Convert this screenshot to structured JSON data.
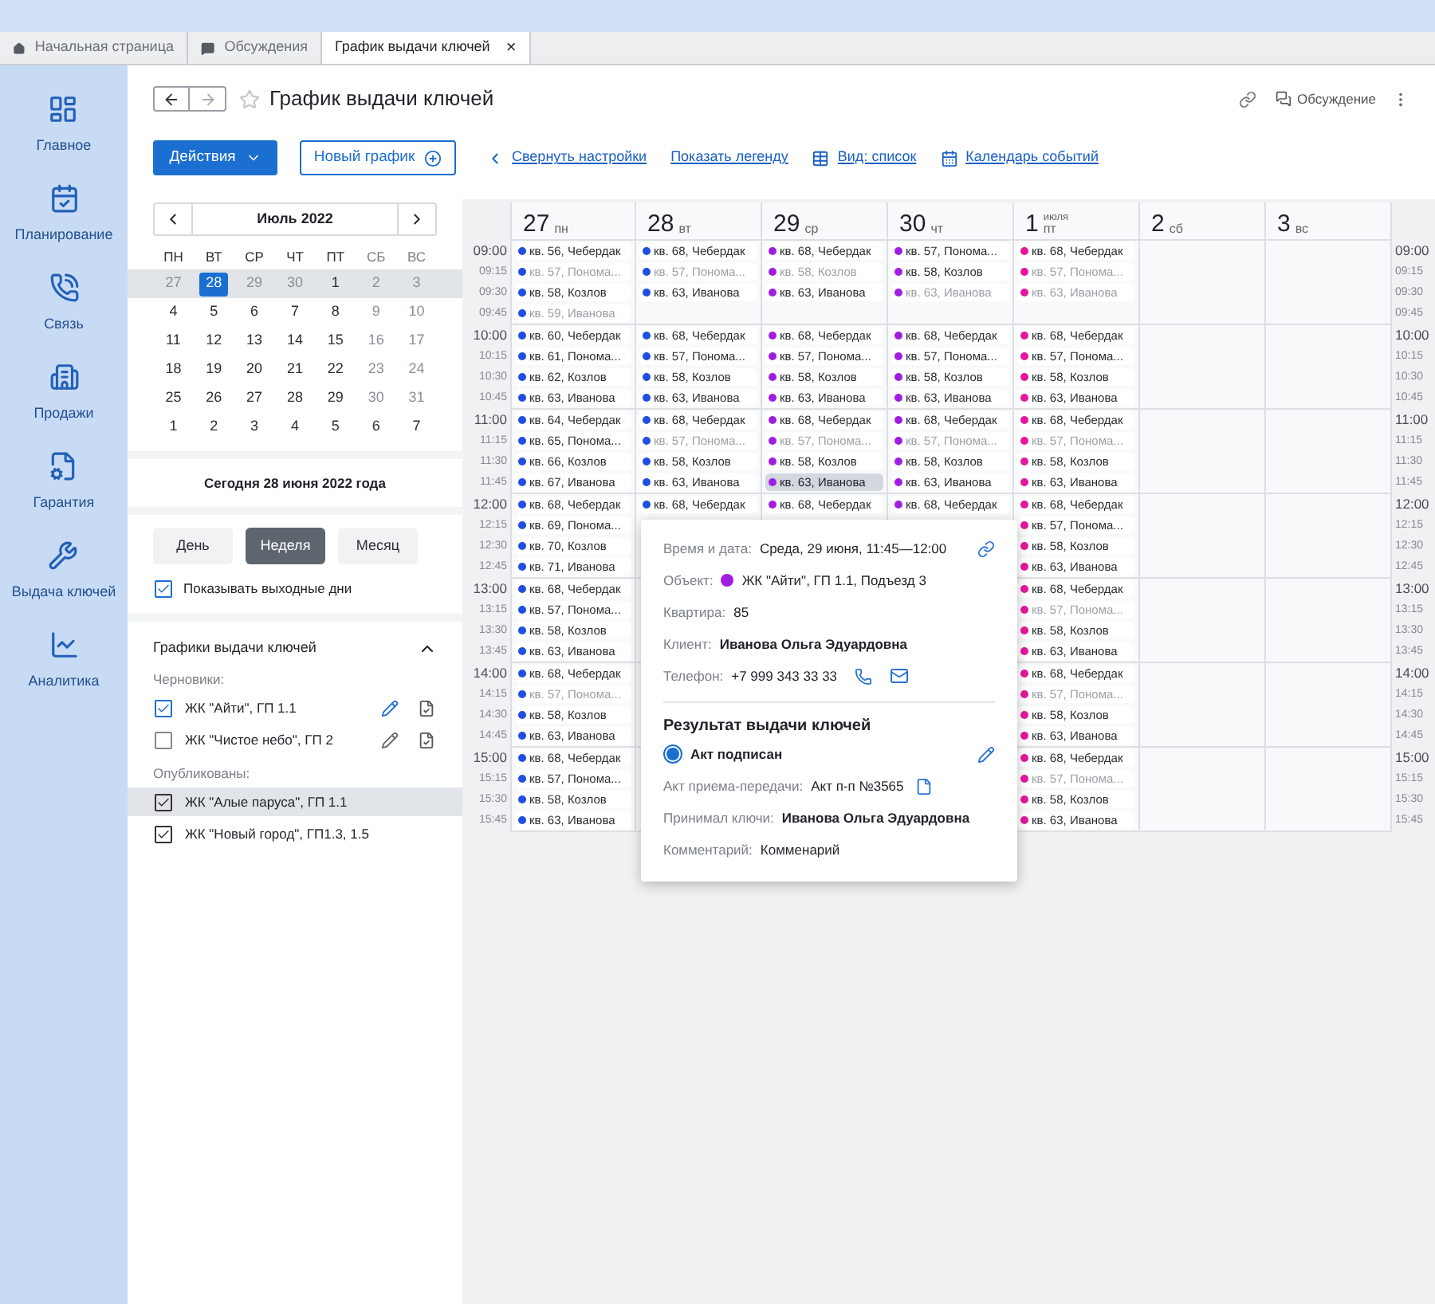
{
  "tabs": [
    {
      "label": "Начальная страница",
      "selected": false
    },
    {
      "label": "Обсуждения",
      "selected": false
    },
    {
      "label": "График выдачи ключей",
      "selected": true,
      "close": "×"
    }
  ],
  "sidebar": {
    "items": [
      {
        "label": "Главное"
      },
      {
        "label": "Планирование"
      },
      {
        "label": "Связь"
      },
      {
        "label": "Продажи"
      },
      {
        "label": "Гарантия"
      },
      {
        "label": "Выдача ключей"
      },
      {
        "label": "Аналитика"
      }
    ]
  },
  "header": {
    "title": "График выдачи ключей",
    "starred": false,
    "discussion": "Обсуждение"
  },
  "toolbar": {
    "actions": "Действия",
    "new_schedule": "Новый график",
    "links": [
      "Свернуть настройки",
      "Показать легенду",
      "Вид: список",
      "Календарь событий"
    ]
  },
  "mini_calendar": {
    "month": "Июль 2022",
    "weekdays": [
      "ПН",
      "ВТ",
      "СР",
      "ЧТ",
      "ПТ",
      "СБ",
      "ВС"
    ],
    "weeks": [
      {
        "current": true,
        "days": [
          {
            "day": "27",
            "muted": true,
            "selected": false
          },
          {
            "day": "28",
            "muted": true,
            "selected": true
          },
          {
            "day": "29",
            "muted": true,
            "selected": false
          },
          {
            "day": "30",
            "muted": true,
            "selected": false
          },
          {
            "day": "1",
            "muted": false,
            "selected": false
          },
          {
            "day": "2",
            "muted": true,
            "selected": false
          },
          {
            "day": "3",
            "muted": true,
            "selected": false
          }
        ]
      },
      {
        "current": false,
        "days": [
          {
            "day": "4",
            "muted": false,
            "selected": false
          },
          {
            "day": "5",
            "muted": false,
            "selected": false
          },
          {
            "day": "6",
            "muted": false,
            "selected": false
          },
          {
            "day": "7",
            "muted": false,
            "selected": false
          },
          {
            "day": "8",
            "muted": false,
            "selected": false
          },
          {
            "day": "9",
            "muted": true,
            "selected": false
          },
          {
            "day": "10",
            "muted": true,
            "selected": false
          }
        ]
      },
      {
        "current": false,
        "days": [
          {
            "day": "11",
            "muted": false,
            "selected": false
          },
          {
            "day": "12",
            "muted": false,
            "selected": false
          },
          {
            "day": "13",
            "muted": false,
            "selected": false
          },
          {
            "day": "14",
            "muted": false,
            "selected": false
          },
          {
            "day": "15",
            "muted": false,
            "selected": false
          },
          {
            "day": "16",
            "muted": true,
            "selected": false
          },
          {
            "day": "17",
            "muted": true,
            "selected": false
          }
        ]
      },
      {
        "current": false,
        "days": [
          {
            "day": "18",
            "muted": false,
            "selected": false
          },
          {
            "day": "19",
            "muted": false,
            "selected": false
          },
          {
            "day": "20",
            "muted": false,
            "selected": false
          },
          {
            "day": "21",
            "muted": false,
            "selected": false
          },
          {
            "day": "22",
            "muted": false,
            "selected": false
          },
          {
            "day": "23",
            "muted": true,
            "selected": false
          },
          {
            "day": "24",
            "muted": true,
            "selected": false
          }
        ]
      },
      {
        "current": false,
        "days": [
          {
            "day": "25",
            "muted": false,
            "selected": false
          },
          {
            "day": "26",
            "muted": false,
            "selected": false
          },
          {
            "day": "27",
            "muted": false,
            "selected": false
          },
          {
            "day": "28",
            "muted": false,
            "selected": false
          },
          {
            "day": "29",
            "muted": false,
            "selected": false
          },
          {
            "day": "30",
            "muted": true,
            "selected": false
          },
          {
            "day": "31",
            "muted": true,
            "selected": false
          }
        ]
      },
      {
        "current": false,
        "days": [
          {
            "day": "1",
            "muted": false,
            "selected": false
          },
          {
            "day": "2",
            "muted": false,
            "selected": false
          },
          {
            "day": "3",
            "muted": false,
            "selected": false
          },
          {
            "day": "4",
            "muted": false,
            "selected": false
          },
          {
            "day": "5",
            "muted": false,
            "selected": false
          },
          {
            "day": "6",
            "muted": false,
            "selected": false
          },
          {
            "day": "7",
            "muted": false,
            "selected": false
          }
        ]
      }
    ],
    "today": "Сегодня 28 июня 2022 года"
  },
  "view_modes": [
    {
      "label": "День",
      "selected": false
    },
    {
      "label": "Неделя",
      "selected": true
    },
    {
      "label": "Месяц",
      "selected": false
    }
  ],
  "show_weekends": {
    "label": "Показывать выходные дни",
    "checked": true
  },
  "schedules": {
    "title": "Графики выдачи ключей",
    "expanded": true,
    "groups": [
      {
        "title": "Черновики:",
        "kind": "draft",
        "items": [
          {
            "label": "ЖК \"Айти\", ГП 1.1",
            "checked": true,
            "selected": false
          },
          {
            "label": "ЖК \"Чистое небо\", ГП 2",
            "checked": false,
            "selected": false
          }
        ]
      },
      {
        "title": "Опубликованы:",
        "kind": "published",
        "items": [
          {
            "label": "ЖК \"Алые паруса\", ГП 1.1",
            "checked": true,
            "selected": true
          },
          {
            "label": "ЖК \"Новый город\", ГП1.3, 1.5",
            "checked": true,
            "selected": false
          }
        ]
      }
    ]
  },
  "time_blocks": [
    {
      "left": [
        "09:00",
        "09:15",
        "09:30",
        "09:45"
      ],
      "right": [
        "09:00",
        "09:15",
        "09:30",
        "09:45"
      ]
    },
    {
      "left": [
        "10:00",
        "10:15",
        "10:30",
        "10:45"
      ],
      "right": [
        "10:00",
        "10:15",
        "10:30",
        "10:45"
      ]
    },
    {
      "left": [
        "11:00",
        "11:15",
        "11:30",
        "11:45"
      ],
      "right": [
        "11:00",
        "11:15",
        "11:30",
        "11:45"
      ]
    },
    {
      "left": [
        "12:00",
        "12:15",
        "12:30",
        "12:45"
      ],
      "right": [
        "12:00",
        "12:15",
        "12:30",
        "12:45"
      ]
    },
    {
      "left": [
        "13:00",
        "13:15",
        "13:30",
        "13:45"
      ],
      "right": [
        "13:00",
        "13:15",
        "13:30",
        "13:45"
      ]
    },
    {
      "left": [
        "14:00",
        "14:15",
        "14:30",
        "14:45"
      ],
      "right": [
        "14:00",
        "14:15",
        "14:30",
        "14:45"
      ]
    },
    {
      "left": [
        "15:00",
        "15:15",
        "15:30",
        "15:45"
      ],
      "right": [
        "15:00",
        "15:15",
        "15:30",
        "15:45"
      ]
    }
  ],
  "days": [
    {
      "date": "27",
      "weekday": "пн",
      "color": "#1f4fe0",
      "blocks": [
        [
          {
            "text": "кв. 56, Чебердак",
            "faded": false,
            "selected": false
          },
          {
            "text": "кв. 57, Понома...",
            "faded": true,
            "selected": false
          },
          {
            "text": "кв. 58, Козлов",
            "faded": false,
            "selected": false
          },
          {
            "text": "кв. 59, Иванова",
            "faded": true,
            "selected": false
          }
        ],
        [
          {
            "text": "кв. 60, Чебердак",
            "faded": false,
            "selected": false
          },
          {
            "text": "кв. 61, Понома...",
            "faded": false,
            "selected": false
          },
          {
            "text": "кв. 62, Козлов",
            "faded": false,
            "selected": false
          },
          {
            "text": "кв. 63, Иванова",
            "faded": false,
            "selected": false
          }
        ],
        [
          {
            "text": "кв. 64, Чебердак",
            "faded": false,
            "selected": false
          },
          {
            "text": "кв. 65, Понома...",
            "faded": false,
            "selected": false
          },
          {
            "text": "кв. 66, Козлов",
            "faded": false,
            "selected": false
          },
          {
            "text": "кв. 67, Иванова",
            "faded": false,
            "selected": false
          }
        ],
        [
          {
            "text": "кв. 68, Чебердак",
            "faded": false,
            "selected": false
          },
          {
            "text": "кв. 69, Понома...",
            "faded": false,
            "selected": false
          },
          {
            "text": "кв. 70, Козлов",
            "faded": false,
            "selected": false
          },
          {
            "text": "кв. 71, Иванова",
            "faded": false,
            "selected": false
          }
        ],
        [
          {
            "text": "кв. 68, Чебердак",
            "faded": false,
            "selected": false
          },
          {
            "text": "кв. 57, Понома...",
            "faded": false,
            "selected": false
          },
          {
            "text": "кв. 58, Козлов",
            "faded": false,
            "selected": false
          },
          {
            "text": "кв. 63, Иванова",
            "faded": false,
            "selected": false
          }
        ],
        [
          {
            "text": "кв. 68, Чебердак",
            "faded": false,
            "selected": false
          },
          {
            "text": "кв. 57, Понома...",
            "faded": true,
            "selected": false
          },
          {
            "text": "кв. 58, Козлов",
            "faded": false,
            "selected": false
          },
          {
            "text": "кв. 63, Иванова",
            "faded": false,
            "selected": false
          }
        ],
        [
          {
            "text": "кв. 68, Чебердак",
            "faded": false,
            "selected": false
          },
          {
            "text": "кв. 57, Понома...",
            "faded": false,
            "selected": false
          },
          {
            "text": "кв. 58, Козлов",
            "faded": false,
            "selected": false
          },
          {
            "text": "кв. 63, Иванова",
            "faded": false,
            "selected": false
          }
        ]
      ]
    },
    {
      "date": "28",
      "weekday": "вт",
      "color": "#1f4fe0",
      "blocks": [
        [
          {
            "text": "кв. 68, Чебердак",
            "faded": false,
            "selected": false
          },
          {
            "text": "кв. 57, Понома...",
            "faded": true,
            "selected": false
          },
          {
            "text": "кв. 63, Иванова",
            "faded": false,
            "selected": false
          }
        ],
        [
          {
            "text": "кв. 68, Чебердак",
            "faded": false,
            "selected": false
          },
          {
            "text": "кв. 57, Понома...",
            "faded": false,
            "selected": false
          },
          {
            "text": "кв. 58, Козлов",
            "faded": false,
            "selected": false
          },
          {
            "text": "кв. 63, Иванова",
            "faded": false,
            "selected": false
          }
        ],
        [
          {
            "text": "кв. 68, Чебердак",
            "faded": false,
            "selected": false
          },
          {
            "text": "кв. 57, Понома...",
            "faded": true,
            "selected": false
          },
          {
            "text": "кв. 58, Козлов",
            "faded": false,
            "selected": false
          },
          {
            "text": "кв. 63, Иванова",
            "faded": false,
            "selected": false
          }
        ],
        [
          {
            "text": "кв. 68, Чебердак",
            "faded": false,
            "selected": false
          }
        ]
      ]
    },
    {
      "date": "29",
      "weekday": "ср",
      "color": "#a01ee0",
      "blocks": [
        [
          {
            "text": "кв. 68, Чебердак",
            "faded": false,
            "selected": false
          },
          {
            "text": "кв. 58, Козлов",
            "faded": true,
            "selected": false
          },
          {
            "text": "кв. 63, Иванова",
            "faded": false,
            "selected": false
          }
        ],
        [
          {
            "text": "кв. 68, Чебердак",
            "faded": false,
            "selected": false
          },
          {
            "text": "кв. 57, Понома...",
            "faded": false,
            "selected": false
          },
          {
            "text": "кв. 58, Козлов",
            "faded": false,
            "selected": false
          },
          {
            "text": "кв. 63, Иванова",
            "faded": false,
            "selected": false
          }
        ],
        [
          {
            "text": "кв. 68, Чебердак",
            "faded": false,
            "selected": false
          },
          {
            "text": "кв. 57, Понома...",
            "faded": true,
            "selected": false
          },
          {
            "text": "кв. 58, Козлов",
            "faded": false,
            "selected": false
          },
          {
            "text": "кв. 63, Иванова",
            "faded": false,
            "selected": true
          }
        ],
        [
          {
            "text": "кв. 68, Чебердак",
            "faded": false,
            "selected": false
          }
        ]
      ]
    },
    {
      "date": "30",
      "weekday": "чт",
      "color": "#a01ee0",
      "blocks": [
        [
          {
            "text": "кв. 57, Понома...",
            "faded": false,
            "selected": false
          },
          {
            "text": "кв. 58, Козлов",
            "faded": false,
            "selected": false
          },
          {
            "text": "кв. 63, Иванова",
            "faded": true,
            "selected": false
          }
        ],
        [
          {
            "text": "кв. 68, Чебердак",
            "faded": false,
            "selected": false
          },
          {
            "text": "кв. 57, Понома...",
            "faded": false,
            "selected": false
          },
          {
            "text": "кв. 58, Козлов",
            "faded": false,
            "selected": false
          },
          {
            "text": "кв. 63, Иванова",
            "faded": false,
            "selected": false
          }
        ],
        [
          {
            "text": "кв. 68, Чебердак",
            "faded": false,
            "selected": false
          },
          {
            "text": "кв. 57, Понома...",
            "faded": true,
            "selected": false
          },
          {
            "text": "кв. 58, Козлов",
            "faded": false,
            "selected": false
          },
          {
            "text": "кв. 63, Иванова",
            "faded": false,
            "selected": false
          }
        ],
        [
          {
            "text": "кв. 68, Чебердак",
            "faded": false,
            "selected": false
          }
        ]
      ]
    },
    {
      "date": "1",
      "weekday": "пт",
      "month": "июля",
      "color": "#e6179c",
      "blocks": [
        [
          {
            "text": "кв. 68, Чебердак",
            "faded": false,
            "selected": false
          },
          {
            "text": "кв. 57, Понома...",
            "faded": true,
            "selected": false
          },
          {
            "text": "кв. 63, Иванова",
            "faded": true,
            "selected": false
          }
        ],
        [
          {
            "text": "кв. 68, Чебердак",
            "faded": false,
            "selected": false
          },
          {
            "text": "кв. 57, Понома...",
            "faded": false,
            "selected": false
          },
          {
            "text": "кв. 58, Козлов",
            "faded": false,
            "selected": false
          },
          {
            "text": "кв. 63, Иванова",
            "faded": false,
            "selected": false
          }
        ],
        [
          {
            "text": "кв. 68, Чебердак",
            "faded": false,
            "selected": false
          },
          {
            "text": "кв. 57, Понома...",
            "faded": true,
            "selected": false
          },
          {
            "text": "кв. 58, Козлов",
            "faded": false,
            "selected": false
          },
          {
            "text": "кв. 63, Иванова",
            "faded": false,
            "selected": false
          }
        ],
        [
          {
            "text": "кв. 68, Чебердак",
            "faded": false,
            "selected": false
          },
          {
            "text": "кв. 57, Понома...",
            "faded": false,
            "selected": false
          },
          {
            "text": "кв. 58, Козлов",
            "faded": false,
            "selected": false
          },
          {
            "text": "кв. 63, Иванова",
            "faded": false,
            "selected": false
          }
        ],
        [
          {
            "text": "кв. 68, Чебердак",
            "faded": false,
            "selected": false
          },
          {
            "text": "кв. 57, Понома...",
            "faded": true,
            "selected": false
          },
          {
            "text": "кв. 58, Козлов",
            "faded": false,
            "selected": false
          },
          {
            "text": "кв. 63, Иванова",
            "faded": false,
            "selected": false
          }
        ],
        [
          {
            "text": "кв. 68, Чебердак",
            "faded": false,
            "selected": false
          },
          {
            "text": "кв. 57, Понома...",
            "faded": true,
            "selected": false
          },
          {
            "text": "кв. 58, Козлов",
            "faded": false,
            "selected": false
          },
          {
            "text": "кв. 63, Иванова",
            "faded": false,
            "selected": false
          }
        ],
        [
          {
            "text": "кв. 68, Чебердак",
            "faded": false,
            "selected": false
          },
          {
            "text": "кв. 57, Понома...",
            "faded": true,
            "selected": false
          },
          {
            "text": "кв. 58, Козлов",
            "faded": false,
            "selected": false
          },
          {
            "text": "кв. 63, Иванова",
            "faded": false,
            "selected": false
          }
        ]
      ]
    },
    {
      "date": "2",
      "weekday": "сб"
    },
    {
      "date": "3",
      "weekday": "вс"
    }
  ],
  "popup": {
    "details": [
      {
        "kind": "datetime",
        "label": "Время и дата:",
        "value": "Среда, 29 июня, 11:45—12:00"
      },
      {
        "kind": "object",
        "label": "Объект:",
        "value": "ЖК \"Айти\", ГП 1.1, Подъезд 3",
        "color": "#a01ee0"
      },
      {
        "kind": "plain",
        "label": "Квартира:",
        "value": "85"
      },
      {
        "kind": "bold",
        "label": "Клиент:",
        "value": "Иванова Ольга Эдуардовна"
      },
      {
        "kind": "phone",
        "label": "Телефон:",
        "value": "+7 999 343 33 33"
      }
    ],
    "result": {
      "title": "Результат выдачи ключей",
      "status": {
        "label": "Акт подписан",
        "selected": true
      },
      "fields": [
        {
          "kind": "document",
          "label": "Акт приема-передачи:",
          "value": "Акт п-п №3565"
        },
        {
          "kind": "bold",
          "label": "Принимал ключи:",
          "value": "Иванова Ольга Эдуардовна"
        },
        {
          "kind": "plain",
          "label": "Комментарий:",
          "value": "Комменарий"
        }
      ]
    }
  }
}
